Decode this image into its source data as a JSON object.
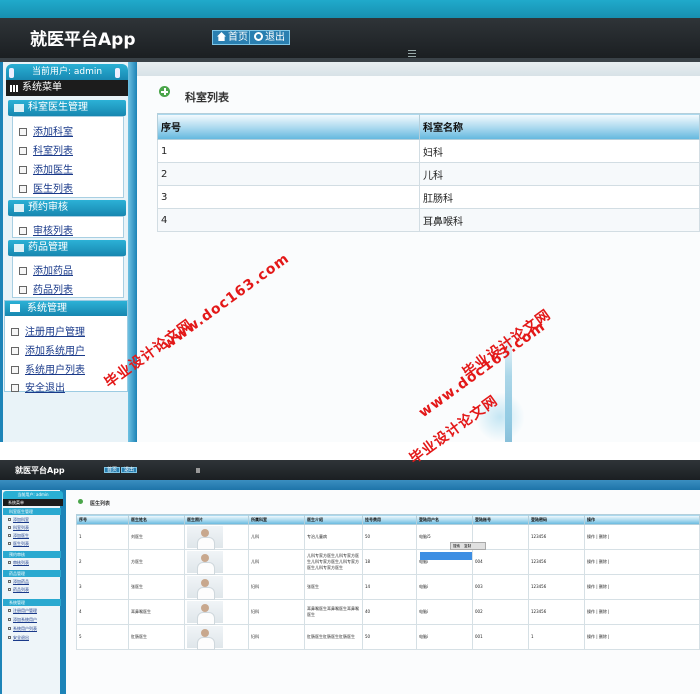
{
  "top": {
    "app_title": "就医平台App",
    "nav": {
      "home": "首页",
      "logout": "退出"
    },
    "current_user": "当前用户: admin",
    "system_menu": "系统菜单",
    "groups": [
      {
        "title": "科室医生管理",
        "items": [
          "添加科室",
          "科室列表",
          "添加医生",
          "医生列表"
        ]
      },
      {
        "title": "预约审核",
        "items": [
          "审核列表"
        ]
      },
      {
        "title": "药品管理",
        "items": [
          "添加药品",
          "药品列表"
        ]
      },
      {
        "title": "系统管理",
        "items": [
          "注册用户管理",
          "添加系统用户",
          "系统用户列表",
          "安全退出"
        ]
      }
    ],
    "page_title": "科室列表",
    "table": {
      "headers": [
        "序号",
        "科室名称"
      ],
      "rows": [
        [
          "1",
          "妇科"
        ],
        [
          "2",
          "儿科"
        ],
        [
          "3",
          "肛肠科"
        ],
        [
          "4",
          "耳鼻喉科"
        ]
      ]
    }
  },
  "watermarks": [
    "毕业设计论文网",
    "www.doc163.com",
    "毕业设计论文网",
    "www.doc163.com",
    "毕业设计论文网"
  ],
  "bottom": {
    "app_title": "就医平台App",
    "nav": {
      "home": "首页",
      "logout": "退出"
    },
    "current_user": "当前用户: admin",
    "system_menu": "系统菜单",
    "groups": [
      {
        "title": "科室医生管理",
        "items": [
          "添加科室",
          "科室列表",
          "添加医生",
          "医生列表"
        ]
      },
      {
        "title": "预约审核",
        "items": [
          "审核列表"
        ]
      },
      {
        "title": "药品管理",
        "items": [
          "添加药品",
          "药品列表"
        ]
      },
      {
        "title": "系统管理",
        "items": [
          "注册用户管理",
          "添加系统用户",
          "系统用户列表",
          "安全退出"
        ]
      }
    ],
    "page_title": "医生列表",
    "popup": {
      "search": "搜索",
      "copy": "复制"
    },
    "table": {
      "headers": [
        "序号",
        "医生姓名",
        "医生照片",
        "所属科室",
        "医生介绍",
        "挂号费用",
        "登陆用户名",
        "登陆账号",
        "登陆密码",
        "操作"
      ],
      "rows": [
        [
          "1",
          "刘医生",
          "",
          "儿科",
          "专治儿童病",
          "50",
          "电脑i5",
          "",
          "123456",
          "操作 | 删除 |"
        ],
        [
          "2",
          "方医生",
          "",
          "儿科",
          "儿科专家方医生儿科专家方医生儿科专家方医生儿科专家方医生儿科专家方医生",
          "18",
          "电脑i",
          "004",
          "123456",
          "操作 | 删除 |"
        ],
        [
          "3",
          "张医生",
          "",
          "妇科",
          "张医生",
          "14",
          "电脑i",
          "003",
          "123456",
          "操作 | 删除 |"
        ],
        [
          "4",
          "耳鼻喉医生",
          "",
          "妇科",
          "耳鼻喉医生耳鼻喉医生耳鼻喉医生",
          "40",
          "电脑i",
          "002",
          "123456",
          "操作 | 删除 |"
        ],
        [
          "5",
          "肛肠医生",
          "",
          "妇科",
          "肛肠医生肛肠医生肛肠医生",
          "50",
          "电脑i",
          "001",
          "1",
          "操作 | 删除 |"
        ]
      ]
    }
  }
}
